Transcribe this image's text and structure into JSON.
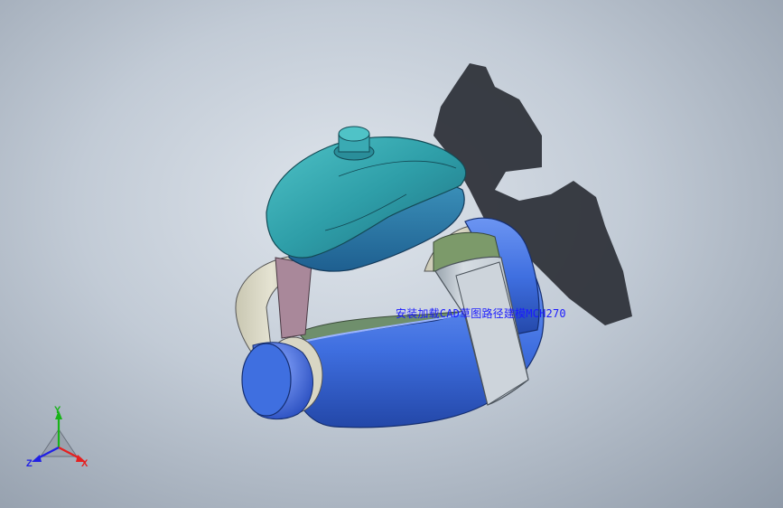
{
  "viewport": {
    "overlay_label": "安装加载CAD草图路径建模MCH270",
    "colors": {
      "background_center": "#dfe5ec",
      "background_edge": "#8f9aa8",
      "shell_teal": "#2e9ea8",
      "shell_teal_dark": "#1f6f82",
      "band_blue": "#3f6fe0",
      "band_blue_dark": "#2347a8",
      "strap_beige": "#d8d6c4",
      "strap_mauve": "#a9889a",
      "battery_box": "#c8d0d8",
      "shadow": "#2b2f36"
    }
  },
  "triad": {
    "x_label": "X",
    "y_label": "Y",
    "z_label": "Z",
    "x_color": "#e52020",
    "y_color": "#18b318",
    "z_color": "#2020e5"
  }
}
